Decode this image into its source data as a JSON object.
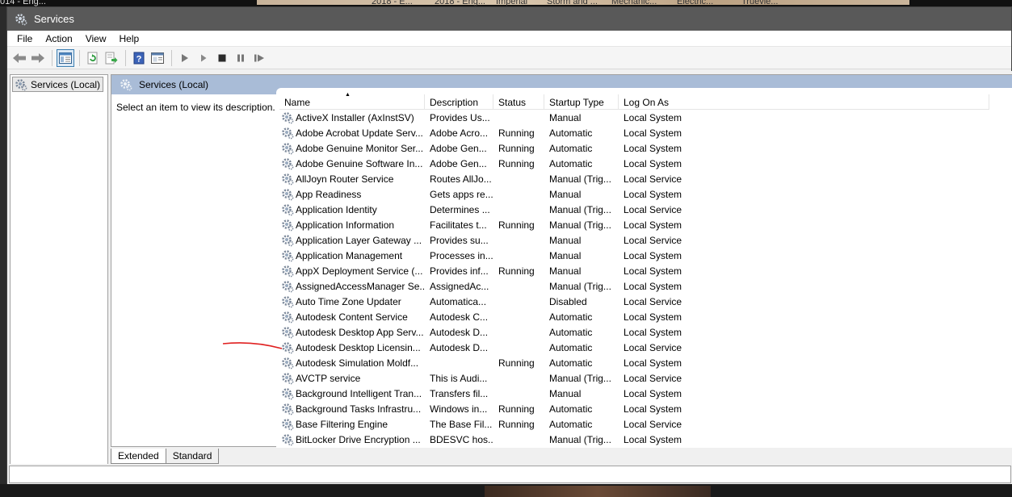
{
  "window": {
    "title": "Services"
  },
  "taskbar_fragments": [
    "014 - Eng...",
    "2018 - E...",
    "2018 - Eng...",
    "Imperial",
    "Storm and ...",
    "Mechanic...",
    "Electric...",
    "Truevie..."
  ],
  "menu": [
    "File",
    "Action",
    "View",
    "Help"
  ],
  "tree": {
    "root_label": "Services (Local)"
  },
  "content": {
    "header_title": "Services (Local)",
    "description_prompt": "Select an item to view its description."
  },
  "columns": {
    "name": "Name",
    "description": "Description",
    "status": "Status",
    "startup_type": "Startup Type",
    "log_on_as": "Log On As"
  },
  "services": [
    {
      "name": "ActiveX Installer (AxInstSV)",
      "description": "Provides Us...",
      "status": "",
      "startup": "Manual",
      "logon": "Local System"
    },
    {
      "name": "Adobe Acrobat Update Serv...",
      "description": "Adobe Acro...",
      "status": "Running",
      "startup": "Automatic",
      "logon": "Local System"
    },
    {
      "name": "Adobe Genuine Monitor Ser...",
      "description": "Adobe Gen...",
      "status": "Running",
      "startup": "Automatic",
      "logon": "Local System"
    },
    {
      "name": "Adobe Genuine Software In...",
      "description": "Adobe Gen...",
      "status": "Running",
      "startup": "Automatic",
      "logon": "Local System"
    },
    {
      "name": "AllJoyn Router Service",
      "description": "Routes AllJo...",
      "status": "",
      "startup": "Manual (Trig...",
      "logon": "Local Service"
    },
    {
      "name": "App Readiness",
      "description": "Gets apps re...",
      "status": "",
      "startup": "Manual",
      "logon": "Local System"
    },
    {
      "name": "Application Identity",
      "description": "Determines ...",
      "status": "",
      "startup": "Manual (Trig...",
      "logon": "Local Service"
    },
    {
      "name": "Application Information",
      "description": "Facilitates t...",
      "status": "Running",
      "startup": "Manual (Trig...",
      "logon": "Local System"
    },
    {
      "name": "Application Layer Gateway ...",
      "description": "Provides su...",
      "status": "",
      "startup": "Manual",
      "logon": "Local Service"
    },
    {
      "name": "Application Management",
      "description": "Processes in...",
      "status": "",
      "startup": "Manual",
      "logon": "Local System"
    },
    {
      "name": "AppX Deployment Service (...",
      "description": "Provides inf...",
      "status": "Running",
      "startup": "Manual",
      "logon": "Local System"
    },
    {
      "name": "AssignedAccessManager Se...",
      "description": "AssignedAc...",
      "status": "",
      "startup": "Manual (Trig...",
      "logon": "Local System"
    },
    {
      "name": "Auto Time Zone Updater",
      "description": "Automatica...",
      "status": "",
      "startup": "Disabled",
      "logon": "Local Service"
    },
    {
      "name": "Autodesk Content Service",
      "description": "Autodesk C...",
      "status": "",
      "startup": "Automatic",
      "logon": "Local System"
    },
    {
      "name": "Autodesk Desktop App Serv...",
      "description": "Autodesk D...",
      "status": "",
      "startup": "Automatic",
      "logon": "Local System"
    },
    {
      "name": "Autodesk Desktop Licensin...",
      "description": "Autodesk D...",
      "status": "",
      "startup": "Automatic",
      "logon": "Local Service"
    },
    {
      "name": "Autodesk Simulation Moldf...",
      "description": "",
      "status": "Running",
      "startup": "Automatic",
      "logon": "Local System"
    },
    {
      "name": "AVCTP service",
      "description": "This is Audi...",
      "status": "",
      "startup": "Manual (Trig...",
      "logon": "Local Service"
    },
    {
      "name": "Background Intelligent Tran...",
      "description": "Transfers fil...",
      "status": "",
      "startup": "Manual",
      "logon": "Local System"
    },
    {
      "name": "Background Tasks Infrastru...",
      "description": "Windows in...",
      "status": "Running",
      "startup": "Automatic",
      "logon": "Local System"
    },
    {
      "name": "Base Filtering Engine",
      "description": "The Base Fil...",
      "status": "Running",
      "startup": "Automatic",
      "logon": "Local Service"
    },
    {
      "name": "BitLocker Drive Encryption ...",
      "description": "BDESVC hos...",
      "status": "",
      "startup": "Manual (Trig...",
      "logon": "Local System"
    }
  ],
  "tabs": {
    "extended": "Extended",
    "standard": "Standard"
  },
  "colors": {
    "titlebar": "#595959",
    "content_header": "#a9bcd7",
    "annotation": "#e02020"
  }
}
